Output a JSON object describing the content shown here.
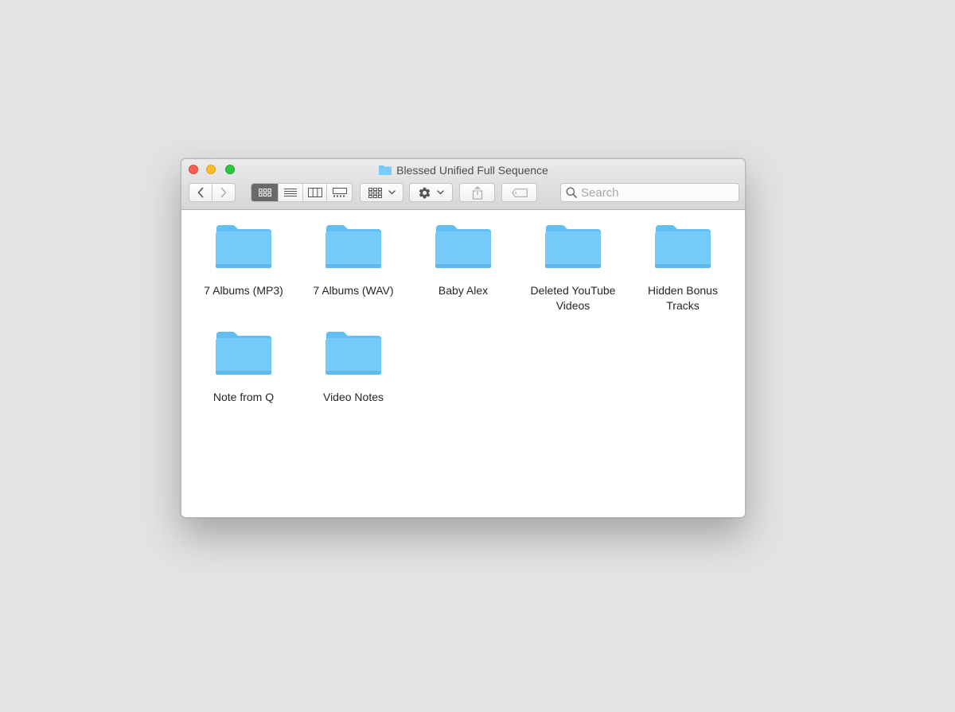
{
  "window": {
    "title": "Blessed Unified Full Sequence"
  },
  "toolbar": {
    "search_placeholder": "Search"
  },
  "files": [
    {
      "name": "7 Albums (MP3)"
    },
    {
      "name": "7 Albums (WAV)"
    },
    {
      "name": "Baby Alex"
    },
    {
      "name": "Deleted YouTube Videos"
    },
    {
      "name": "Hidden Bonus Tracks"
    },
    {
      "name": "Note from Q"
    },
    {
      "name": "Video Notes"
    }
  ],
  "colors": {
    "folder": "#6cc6f7",
    "close": "#fd5f57",
    "minimize": "#febc2e",
    "maximize": "#28c840"
  }
}
